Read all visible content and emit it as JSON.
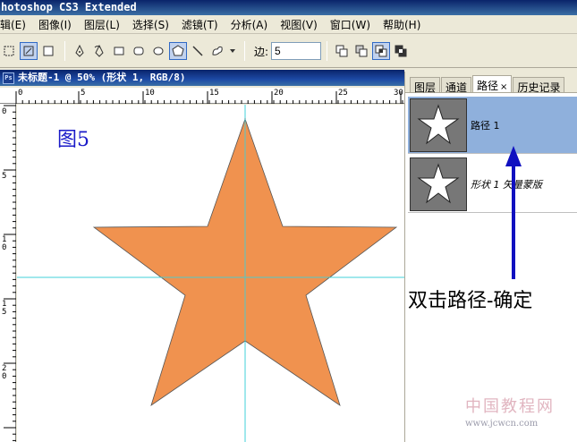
{
  "app": {
    "title": "hotoshop CS3 Extended"
  },
  "menu": [
    "辑(E)",
    "图像(I)",
    "图层(L)",
    "选择(S)",
    "滤镜(T)",
    "分析(A)",
    "视图(V)",
    "窗口(W)",
    "帮助(H)"
  ],
  "options": {
    "sides_label": "边:",
    "sides_value": "5"
  },
  "document": {
    "title": "未标题-1 @ 50% (形状 1, RGB/8)",
    "ps_badge": "Ps",
    "ruler_h": [
      "0",
      "5",
      "10",
      "15",
      "20",
      "25",
      "30"
    ],
    "ruler_v": [
      "0",
      "5",
      "10",
      "15",
      "20"
    ],
    "figure_label": "图5"
  },
  "colors": {
    "star_fill": "#f0924f",
    "guide": "#40d0d8",
    "label_blue": "#1a1ac8",
    "arrow_blue": "#1010c0",
    "selected_row": "#8fb0dc"
  },
  "panel": {
    "tabs": [
      "图层",
      "通道",
      "路径",
      "历史记录"
    ],
    "active_tab": "路径",
    "close_glyph": "×",
    "paths": [
      {
        "name": "路径 1",
        "selected": true
      },
      {
        "name": "形状 1 矢量蒙版",
        "selected": false
      }
    ]
  },
  "annotation": "双击路径-确定",
  "watermark": {
    "title": "中国教程网",
    "url": "www.jcwcn.com"
  }
}
